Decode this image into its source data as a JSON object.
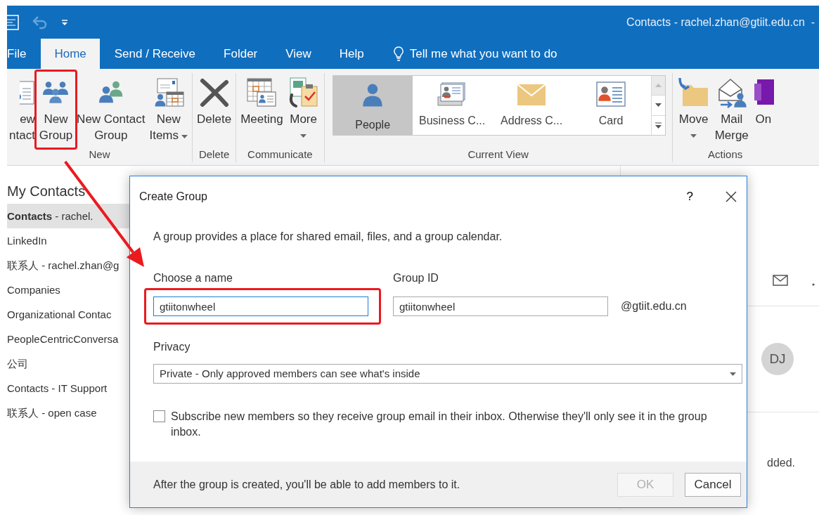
{
  "title_bar": {
    "quick_access": [
      {
        "kind": "form",
        "disabled": false
      },
      {
        "kind": "undo",
        "disabled": true
      },
      {
        "kind": "customize",
        "disabled": false
      }
    ],
    "title": "Contacts - rachel.zhan@gtiit.edu.cn  -"
  },
  "tabs": [
    {
      "label": "File",
      "selected": false
    },
    {
      "label": "Home",
      "selected": true
    },
    {
      "label": "Send / Receive",
      "selected": false
    },
    {
      "label": "Folder",
      "selected": false
    },
    {
      "label": "View",
      "selected": false
    },
    {
      "label": "Help",
      "selected": false
    }
  ],
  "tell_me": "Tell me what you want to do",
  "ribbon": {
    "groups": [
      {
        "label": "New",
        "buttons": [
          {
            "kind": "contact",
            "lines": [
              "ew",
              "ntact"
            ]
          },
          {
            "kind": "group",
            "lines": [
              "New",
              "Group"
            ]
          },
          {
            "kind": "contact-group",
            "lines": [
              "New Contact",
              "Group"
            ]
          },
          {
            "kind": "new-items",
            "lines": [
              "New",
              "Items"
            ],
            "dropdown": true
          }
        ]
      },
      {
        "label": "Delete",
        "buttons": [
          {
            "kind": "delete",
            "lines": [
              "Delete"
            ]
          }
        ]
      },
      {
        "label": "Communicate",
        "buttons": [
          {
            "kind": "meeting",
            "lines": [
              "Meeting"
            ]
          },
          {
            "kind": "more",
            "lines": [
              "More"
            ],
            "dropdown": true
          }
        ]
      },
      {
        "label": "Current View",
        "gallery": [
          {
            "kind": "people",
            "label": "People",
            "selected": true
          },
          {
            "kind": "business-card",
            "label": "Business C...",
            "selected": false
          },
          {
            "kind": "address-card",
            "label": "Address C...",
            "selected": false
          },
          {
            "kind": "card",
            "label": "Card",
            "selected": false
          }
        ]
      },
      {
        "label": "Actions",
        "buttons": [
          {
            "kind": "move",
            "lines": [
              "Move"
            ],
            "dropdown": true
          },
          {
            "kind": "mail-merge",
            "lines": [
              "Mail",
              "Merge"
            ]
          },
          {
            "kind": "onenote",
            "lines": [
              "On"
            ]
          }
        ]
      }
    ]
  },
  "navigation": {
    "heading": "My Contacts",
    "items": [
      {
        "label": "**Contacts** - rachel.",
        "selected": true
      },
      {
        "label": "LinkedIn",
        "selected": false
      },
      {
        "label": "联系人 - rachel.zhan@g",
        "selected": false
      },
      {
        "label": "Companies",
        "selected": false
      },
      {
        "label": "Organizational Contac",
        "selected": false
      },
      {
        "label": "PeopleCentricConversa",
        "selected": false
      },
      {
        "label": "公司",
        "selected": false
      },
      {
        "label": "Contacts - IT Support",
        "selected": false
      },
      {
        "label": "联系人 - open case",
        "selected": false
      }
    ]
  },
  "reading_pane": {
    "avatar_initials": "DJ",
    "note": "dded."
  },
  "dialog": {
    "title": "Create Group",
    "help": "?",
    "description": "A group provides a place for shared email, files, and a group calendar.",
    "name_label": "Choose a name",
    "name_value": "gtiitonwheel",
    "group_id_label": "Group ID",
    "group_id_value": "gtiitonwheel",
    "domain": "@gtiit.edu.cn",
    "privacy_label": "Privacy",
    "privacy_value": "Private - Only approved members can see what's inside",
    "subscribe": {
      "label": "Subscribe new members so they receive group email in their inbox. Otherwise they'll only see it in the group inbox.",
      "checked": false
    },
    "footer_note": "After the group is created, you'll be able to add members to it.",
    "buttons": [
      {
        "label": "OK",
        "disabled": true
      },
      {
        "label": "Cancel",
        "disabled": false
      }
    ]
  },
  "annotations": {
    "highlight_new_group": true,
    "highlight_name_field": true,
    "arrow": true
  }
}
